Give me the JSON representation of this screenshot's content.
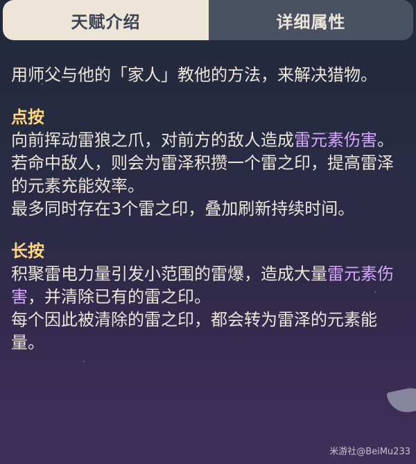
{
  "tabs": [
    {
      "label": "天赋介绍",
      "active": true
    },
    {
      "label": "详细属性",
      "active": false
    }
  ],
  "intro": "用师父与他的「家人」教他的方法，来解决猎物。",
  "sections": [
    {
      "heading": "点按",
      "lines": [
        {
          "pre": "向前挥动雷狼之爪，对前方的敌人造成",
          "highlight": "雷元素伤害",
          "post": "。"
        },
        {
          "pre": "若命中敌人，则会为雷泽积攒一个雷之印，提高雷泽的元素充能效率。",
          "highlight": "",
          "post": ""
        },
        {
          "pre": "最多同时存在3个雷之印，叠加刷新持续时间。",
          "highlight": "",
          "post": ""
        }
      ]
    },
    {
      "heading": "长按",
      "lines": [
        {
          "pre": "积聚雷电力量引发小范围的雷爆，造成大量",
          "highlight": "雷元素伤害",
          "post": "，并清除已有的雷之印。"
        },
        {
          "pre": "每个因此被清除的雷之印，都会转为雷泽的元素能量。",
          "highlight": "",
          "post": ""
        }
      ]
    }
  ],
  "watermark": "米游社@BeiMu233",
  "colors": {
    "heading": "#ffd780",
    "highlight": "#d9a6ff",
    "text": "#ece5d8"
  }
}
